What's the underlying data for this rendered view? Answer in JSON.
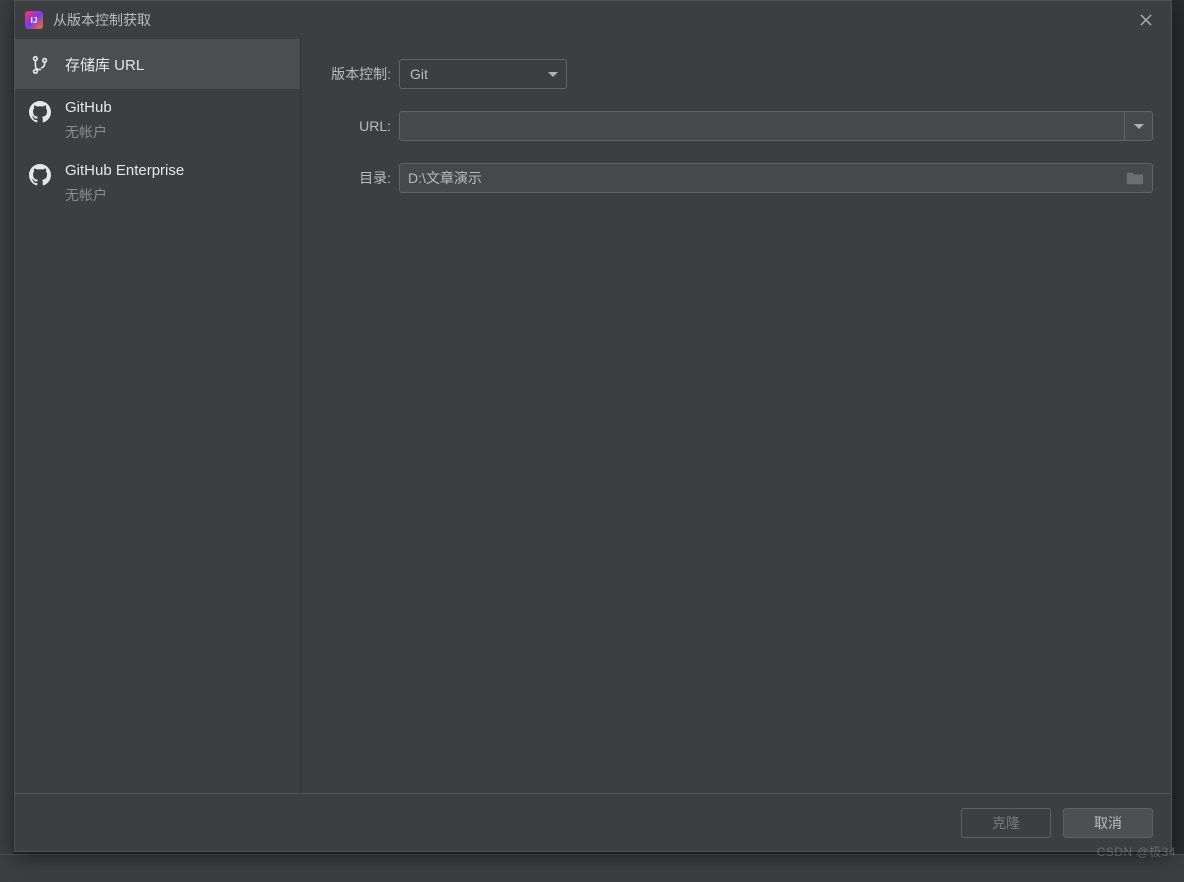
{
  "titlebar": {
    "title": "从版本控制获取",
    "close_icon": "close-icon"
  },
  "sidebar": {
    "items": [
      {
        "icon": "branch-icon",
        "label": "存储库 URL",
        "sub": ""
      },
      {
        "icon": "github-icon",
        "label": "GitHub",
        "sub": "无帐户"
      },
      {
        "icon": "github-icon",
        "label": "GitHub Enterprise",
        "sub": "无帐户"
      }
    ]
  },
  "form": {
    "vcs_label": "版本控制:",
    "vcs_value": "Git",
    "url_label": "URL:",
    "url_value": "",
    "dir_label": "目录:",
    "dir_value": "D:\\文章演示"
  },
  "footer": {
    "clone_label": "克隆",
    "cancel_label": "取消"
  },
  "watermark": "CSDN @极34",
  "colors": {
    "dialog_bg": "#3c3f41",
    "editor_bg": "#2b2b2b",
    "border": "#515151",
    "text": "#bbbbbb"
  }
}
